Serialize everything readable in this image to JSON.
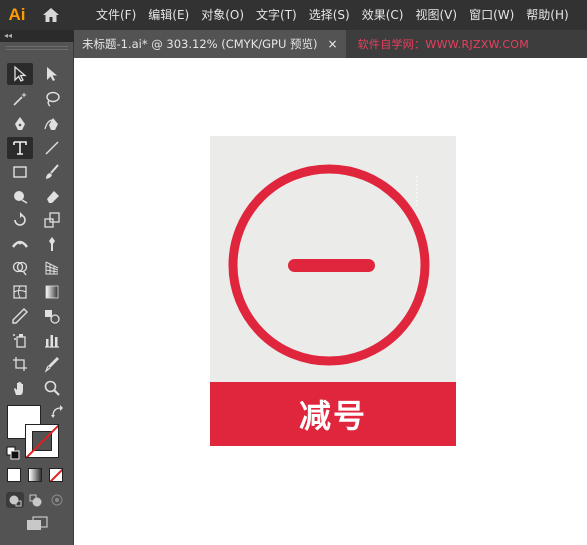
{
  "app": {
    "logo_text": "Ai"
  },
  "menu": [
    "文件(F)",
    "编辑(E)",
    "对象(O)",
    "文字(T)",
    "选择(S)",
    "效果(C)",
    "视图(V)",
    "窗口(W)",
    "帮助(H)"
  ],
  "tab": {
    "title": "未标题-1.ai* @ 303.12% (CMYK/GPU 预览)",
    "close": "×"
  },
  "watermark": "软件自学网：WWW.RJZXW.COM",
  "toolbar": {
    "collapse": "◂◂"
  },
  "artwork": {
    "label": "减号",
    "colors": {
      "accent": "#e0263c",
      "background": "#ebebea"
    }
  }
}
